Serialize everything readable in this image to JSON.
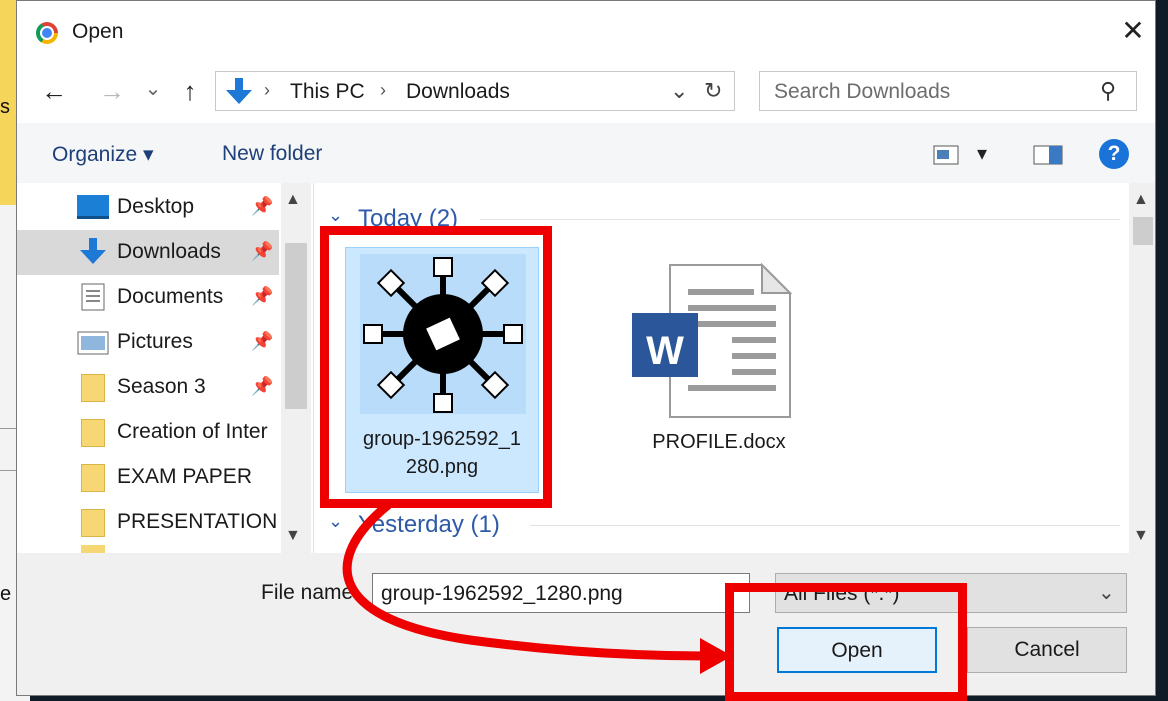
{
  "dialog": {
    "title": "Open",
    "close_glyph": "✕"
  },
  "nav": {
    "back": "←",
    "forward": "→",
    "recent": "⌄",
    "up": "↑"
  },
  "address": {
    "sep1": "›",
    "crumb1": "This PC",
    "sep2": "›",
    "crumb2": "Downloads",
    "dropdown": "⌄",
    "refresh": "↻"
  },
  "search": {
    "placeholder": "Search Downloads",
    "icon": "⚲"
  },
  "toolbar": {
    "organize": "Organize ▾",
    "new_folder": "New folder",
    "view_arrow": "▾",
    "help": "?"
  },
  "sidebar": {
    "items": [
      {
        "label": "Desktop",
        "icon": "desktop-icon",
        "pinned": true
      },
      {
        "label": "Downloads",
        "icon": "download-arrow-icon",
        "pinned": true
      },
      {
        "label": "Documents",
        "icon": "documents-icon",
        "pinned": true
      },
      {
        "label": "Pictures",
        "icon": "pictures-icon",
        "pinned": true
      },
      {
        "label": "Season 3",
        "icon": "folder-icon",
        "pinned": true
      },
      {
        "label": "Creation of Inter",
        "icon": "folder-icon",
        "pinned": false
      },
      {
        "label": "EXAM PAPER",
        "icon": "folder-icon",
        "pinned": false
      },
      {
        "label": "PRESENTATION F",
        "icon": "folder-icon",
        "pinned": false
      }
    ],
    "pin_glyph": "📌"
  },
  "groups": {
    "today": "Today (2)",
    "yesterday": "Yesterday (1)",
    "chevron": "⌄"
  },
  "files": [
    {
      "name_line1": "group-1962592_1",
      "name_line2": "280.png",
      "selected": true
    },
    {
      "name_line1": "PROFILE.docx",
      "name_line2": "",
      "selected": false
    }
  ],
  "word_letter": "W",
  "bottom": {
    "file_name_label": "File name:",
    "file_name_value": "group-1962592_1280.png",
    "filter_value": "All Files (*.*)",
    "open_button": "Open",
    "cancel_button": "Cancel"
  },
  "background": {
    "frag1": "s",
    "frag2": "e"
  },
  "colors": {
    "annotation_red": "#ee0000",
    "link_blue": "#2e5aa8",
    "selection_blue": "#cce8ff"
  }
}
